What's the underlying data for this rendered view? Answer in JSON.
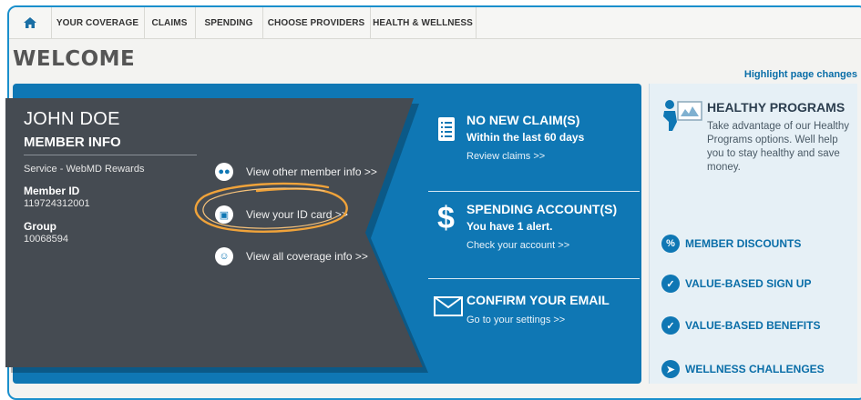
{
  "nav": {
    "home_icon": "home-icon",
    "items": [
      "YOUR COVERAGE",
      "CLAIMS",
      "SPENDING",
      "CHOOSE PROVIDERS",
      "HEALTH & WELLNESS"
    ]
  },
  "page": {
    "title": "WELCOME",
    "highlight_link": "Highlight page changes"
  },
  "member": {
    "name": "JOHN DOE",
    "section_title": "MEMBER INFO",
    "service": "Service - WebMD Rewards",
    "member_id_label": "Member ID",
    "member_id": "119724312001",
    "group_label": "Group",
    "group": "10068594",
    "links": [
      {
        "label": "View other member info >>",
        "icon": "members-icon"
      },
      {
        "label": "View your ID card >>",
        "icon": "id-card-icon"
      },
      {
        "label": "View all coverage info >>",
        "icon": "family-icon"
      }
    ]
  },
  "actions": {
    "claims": {
      "title": "NO NEW CLAIM(S)",
      "subtitle": "Within the last 60 days",
      "link": "Review claims >>",
      "icon": "document-list-icon"
    },
    "spending": {
      "title": "SPENDING ACCOUNT(S)",
      "subtitle": "You have 1 alert.",
      "link": "Check your account >>",
      "icon": "dollar-icon"
    },
    "email": {
      "title": "CONFIRM YOUR EMAIL",
      "link": "Go to your settings >>",
      "icon": "envelope-icon"
    }
  },
  "sidebar": {
    "healthy_title": "HEALTHY PROGRAMS",
    "healthy_text": "Take advantage of our Healthy Programs options. Well help you to stay healthy and save money.",
    "links": [
      {
        "label": "MEMBER DISCOUNTS",
        "icon": "discount-icon"
      },
      {
        "label": "VALUE-BASED SIGN UP",
        "icon": "clipboard-icon"
      },
      {
        "label": "VALUE-BASED BENEFITS",
        "icon": "clipboard-check-icon"
      },
      {
        "label": "WELLNESS CHALLENGES",
        "icon": "runner-icon"
      }
    ]
  },
  "colors": {
    "brand_blue": "#0f77b4",
    "card_dark": "#454b52",
    "link_blue": "#0a6ea8",
    "highlight_orange": "#f0a33a"
  }
}
